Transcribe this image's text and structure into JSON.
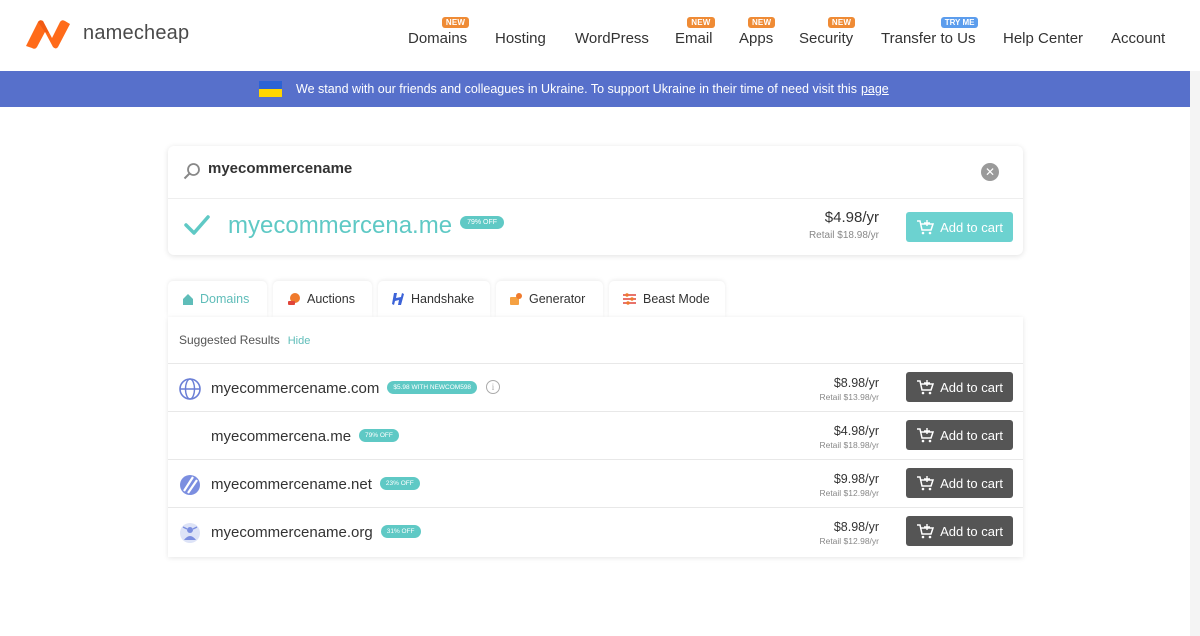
{
  "brand": {
    "name": "namecheap",
    "accent": "#ff5a1f"
  },
  "nav": {
    "items": [
      {
        "label": "Domains",
        "badge": "NEW"
      },
      {
        "label": "Hosting",
        "badge": ""
      },
      {
        "label": "WordPress",
        "badge": ""
      },
      {
        "label": "Email",
        "badge": "NEW"
      },
      {
        "label": "Apps",
        "badge": "NEW"
      },
      {
        "label": "Security",
        "badge": "NEW"
      },
      {
        "label": "Transfer to Us",
        "badge": "TRY ME"
      },
      {
        "label": "Help Center",
        "badge": ""
      },
      {
        "label": "Account",
        "badge": ""
      }
    ]
  },
  "banner": {
    "text": "We stand with our friends and colleagues in Ukraine. To support Ukraine in their time of need visit this",
    "link": "page",
    "color": "#5770cb"
  },
  "search": {
    "value": "myecommercename",
    "featured": {
      "domain": "myecommercena.me",
      "badge": "79% OFF",
      "price": "$4.98/yr",
      "retail": "Retail $18.98/yr",
      "cart_label": "Add to cart"
    }
  },
  "tabs": [
    {
      "label": "Domains",
      "icon": "home-icon"
    },
    {
      "label": "Auctions",
      "icon": "auction-icon"
    },
    {
      "label": "Handshake",
      "icon": "handshake-icon"
    },
    {
      "label": "Generator",
      "icon": "generator-icon"
    },
    {
      "label": "Beast Mode",
      "icon": "beast-mode-icon"
    }
  ],
  "results": {
    "header": "Suggested Results",
    "hide_label": "Hide",
    "rows": [
      {
        "domain": "myecommercename.com",
        "badge": "$5.98 WITH NEWCOM598",
        "price": "$8.98/yr",
        "retail": "Retail $13.98/yr",
        "cart_label": "Add to cart",
        "icon": "globe-icon"
      },
      {
        "domain": "myecommercena.me",
        "badge": "79% OFF",
        "price": "$4.98/yr",
        "retail": "Retail $18.98/yr",
        "cart_label": "Add to cart",
        "icon": ""
      },
      {
        "domain": "myecommercename.net",
        "badge": "23% OFF",
        "price": "$9.98/yr",
        "retail": "Retail $12.98/yr",
        "cart_label": "Add to cart",
        "icon": "net-icon"
      },
      {
        "domain": "myecommercename.org",
        "badge": "31% OFF",
        "price": "$8.98/yr",
        "retail": "Retail $12.98/yr",
        "cart_label": "Add to cart",
        "icon": "org-icon"
      }
    ]
  }
}
